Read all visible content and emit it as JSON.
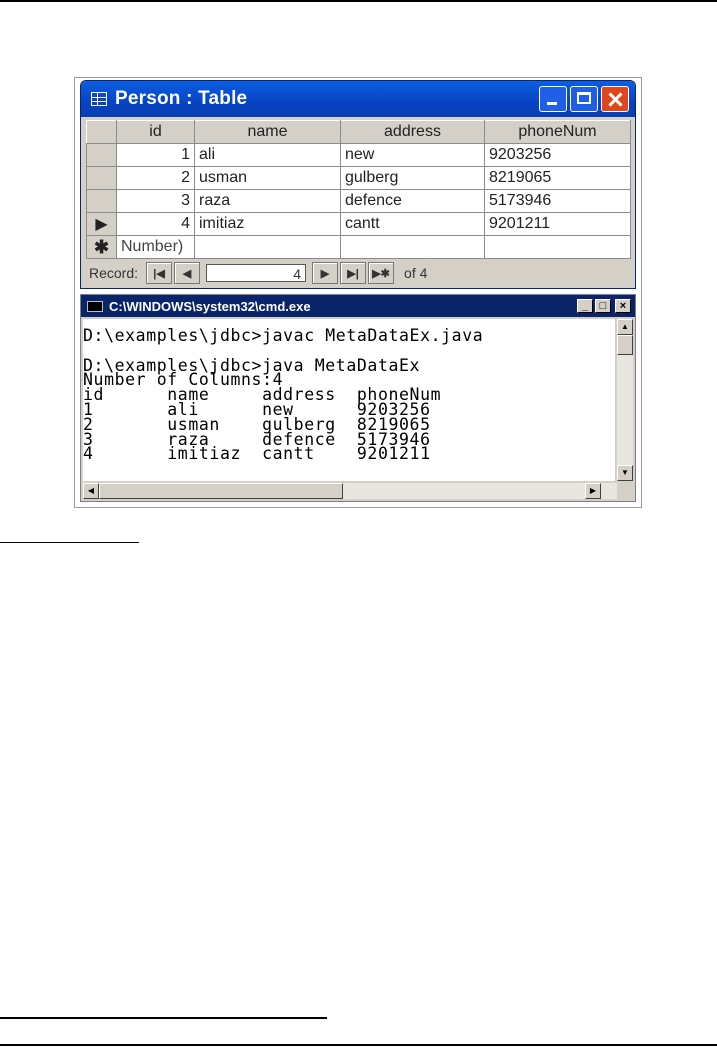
{
  "access_window": {
    "title": "Person : Table",
    "columns": [
      "id",
      "name",
      "address",
      "phoneNum"
    ],
    "rows": [
      {
        "id": "1",
        "name": "ali",
        "address": "new",
        "phoneNum": "9203256"
      },
      {
        "id": "2",
        "name": "usman",
        "address": "gulberg",
        "phoneNum": "8219065"
      },
      {
        "id": "3",
        "name": "raza",
        "address": "defence",
        "phoneNum": "5173946"
      },
      {
        "id": "4",
        "name": "imitiaz",
        "address": "cantt",
        "phoneNum": "9201211"
      }
    ],
    "new_row_placeholder": "Number)",
    "nav": {
      "record_label": "Record:",
      "current": "4",
      "of_label": "of 4"
    }
  },
  "cmd_window": {
    "title": "C:\\WINDOWS\\system32\\cmd.exe",
    "output": "D:\\examples\\jdbc>javac MetaDataEx.java\n\nD:\\examples\\jdbc>java MetaDataEx\nNumber of Columns:4\nid      name     address  phoneNum\n1       ali      new      9203256\n2       usman    gulberg  8219065\n3       raza     defence  5173946\n4       imitiaz  cantt    9201211"
  },
  "icons": [
    "table-icon",
    "minimize-icon",
    "maximize-icon",
    "close-icon",
    "console-icon",
    "record-selector-arrow-icon",
    "new-record-asterisk-icon",
    "first-record-icon",
    "previous-record-icon",
    "next-record-icon",
    "last-record-icon",
    "new-record-nav-icon",
    "scroll-up-icon",
    "scroll-down-icon",
    "scroll-left-icon",
    "scroll-right-icon",
    "resize-grip-icon"
  ],
  "colors": {
    "xp_titlebar": "#0843c4",
    "xp_close": "#e0461c",
    "w2k_titlebar": "#0a246a",
    "chrome_gray": "#d4d0c8"
  }
}
